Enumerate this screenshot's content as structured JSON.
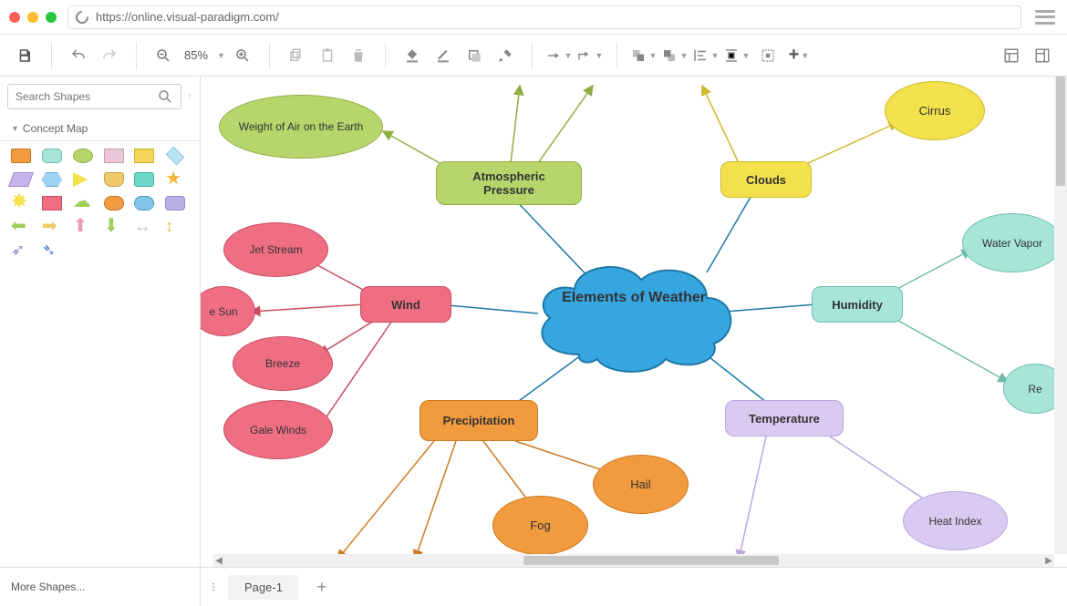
{
  "url": "https://online.visual-paradigm.com/",
  "zoom_label": "85%",
  "search_placeholder": "Search Shapes",
  "palette_title": "Concept Map",
  "more_shapes_label": "More Shapes...",
  "page_tab_label": "Page-1",
  "diagram": {
    "central": {
      "label": "Elements of Weather",
      "fill": "#35a6df",
      "stroke": "#1f79a6"
    },
    "categories": [
      {
        "id": "atm",
        "label": "Atmospheric Pressure",
        "fill": "#b6d66b",
        "stroke": "#8fae44"
      },
      {
        "id": "clouds",
        "label": "Clouds",
        "fill": "#f2e14b",
        "stroke": "#cfb92a"
      },
      {
        "id": "humid",
        "label": "Humidity",
        "fill": "#a7e6d7",
        "stroke": "#6fbcae"
      },
      {
        "id": "temp",
        "label": "Temperature",
        "fill": "#d8caf1",
        "stroke": "#b9a6e0"
      },
      {
        "id": "precip",
        "label": "Precipitation",
        "fill": "#f19a3e",
        "stroke": "#cf7a20"
      },
      {
        "id": "wind",
        "label": "Wind",
        "fill": "#ef6e82",
        "stroke": "#c94c63"
      }
    ],
    "subs": {
      "atm": [
        {
          "label": "Weight of Air on the Earth"
        }
      ],
      "clouds": [
        {
          "label": "Cirrus"
        }
      ],
      "humid": [
        {
          "label": "Water Vapor"
        },
        {
          "label": "Re"
        }
      ],
      "temp": [
        {
          "label": "Heat Index"
        }
      ],
      "precip": [
        {
          "label": "Hail"
        },
        {
          "label": "Fog"
        }
      ],
      "wind": [
        {
          "label": "Jet Stream"
        },
        {
          "label": "e Sun"
        },
        {
          "label": "Breeze"
        },
        {
          "label": "Gale Winds"
        }
      ]
    }
  }
}
